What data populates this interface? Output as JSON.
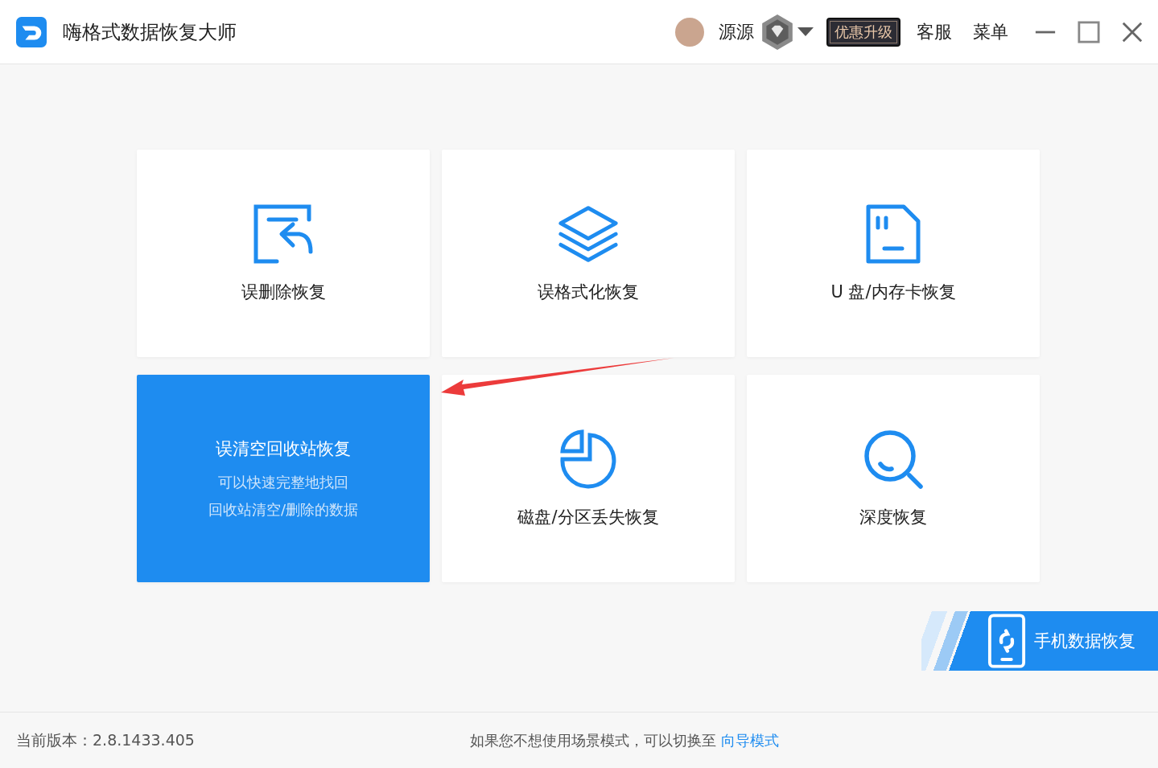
{
  "window": {
    "title": "嗨格式数据恢复大师"
  },
  "header": {
    "username": "源源",
    "upgrade": "优惠升级",
    "service": "客服",
    "menu": "菜单"
  },
  "cards": [
    {
      "kind": "delete",
      "title": "误删除恢复",
      "selected": false
    },
    {
      "kind": "format",
      "title": "误格式化恢复",
      "selected": false
    },
    {
      "kind": "usb",
      "title": "U 盘/内存卡恢复",
      "selected": false
    },
    {
      "title": "误清空回收站恢复",
      "selected": true,
      "description": [
        "可以快速完整地找回",
        "回收站清空/删除的数据"
      ]
    },
    {
      "kind": "partition",
      "title": "磁盘/分区丢失恢复",
      "selected": false
    },
    {
      "kind": "deep",
      "title": "深度恢复",
      "selected": false
    }
  ],
  "mobile_banner": {
    "label": "手机数据恢复"
  },
  "status_bar": {
    "version": "当前版本：2.8.1433.405",
    "hint": "如果您不想使用场景模式，可以切换至",
    "link": "向导模式"
  }
}
